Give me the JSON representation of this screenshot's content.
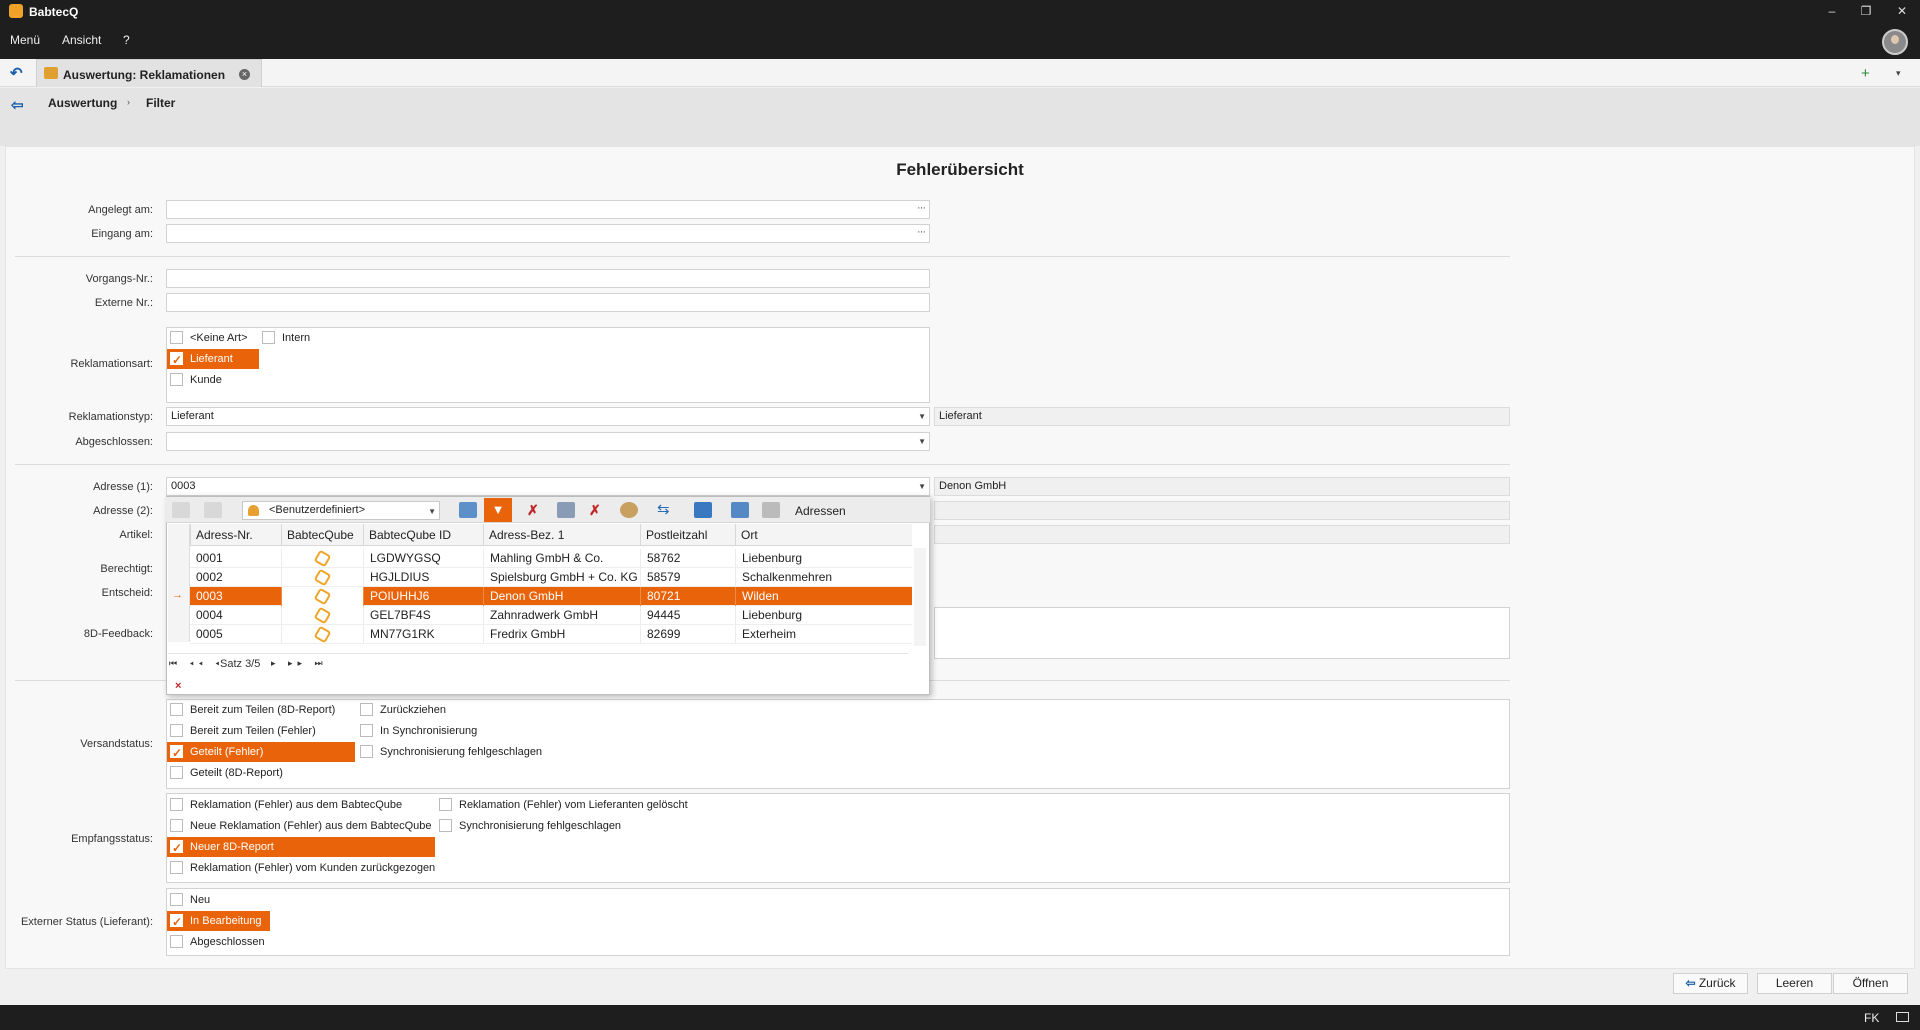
{
  "app": {
    "title": "BabtecQ",
    "menu": [
      "Menü",
      "Ansicht",
      "?"
    ]
  },
  "tabs": {
    "active_label": "Auswertung: Reklamationen"
  },
  "breadcrumb": [
    "Auswertung",
    "Filter"
  ],
  "page_title": "Fehlerübersicht",
  "fields": {
    "angelegt_label": "Angelegt am:",
    "eingang_label": "Eingang am:",
    "vorgang_label": "Vorgangs-Nr.:",
    "extern_label": "Externe Nr.:",
    "reklamationsart_label": "Reklamationsart:",
    "reklamationstyp_label": "Reklamationstyp:",
    "reklamationstyp_value": "Lieferant",
    "reklamationstyp_display": "Lieferant",
    "abgeschlossen_label": "Abgeschlossen:",
    "adresse1_label": "Adresse (1):",
    "adresse1_value": "0003",
    "adresse1_display": "Denon GmbH",
    "adresse2_label": "Adresse (2):",
    "artikel_label": "Artikel:",
    "berechtigt_label": "Berechtigt:",
    "entscheid_label": "Entscheid:",
    "feedback_label": "8D-Feedback:",
    "versand_label": "Versandstatus:",
    "empfang_label": "Empfangsstatus:",
    "extstatus_label": "Externer Status (Lieferant):"
  },
  "reklamationsart": [
    "<Keine Art>",
    "Intern",
    "Lieferant",
    "Kunde"
  ],
  "versandstatus": [
    "Bereit zum Teilen (8D-Report)",
    "Bereit zum Teilen (Fehler)",
    "Geteilt (Fehler)",
    "Geteilt (8D-Report)",
    "Zurückziehen",
    "In Synchronisierung",
    "Synchronisierung fehlgeschlagen"
  ],
  "empfangsstatus": [
    "Reklamation (Fehler) aus dem BabtecQube",
    "Neue Reklamation (Fehler) aus dem BabtecQube",
    "Neuer 8D-Report",
    "Reklamation (Fehler) vom Kunden zurückgezogen",
    "Reklamation (Fehler) vom Lieferanten gelöscht",
    "Synchronisierung fehlgeschlagen"
  ],
  "externer_status": [
    "Neu",
    "In Bearbeitung",
    "Abgeschlossen"
  ],
  "popup": {
    "layout_select": "<Benutzerdefiniert>",
    "title": "Adressen",
    "columns": [
      "Adress-Nr.",
      "BabtecQube",
      "BabtecQube ID",
      "Adress-Bez. 1",
      "Postleitzahl",
      "Ort"
    ],
    "rows": [
      {
        "nr": "0001",
        "id": "LGDWYGSQ",
        "bez": "Mahling GmbH & Co.",
        "plz": "58762",
        "ort": "Liebenburg"
      },
      {
        "nr": "0002",
        "id": "HGJLDIUS",
        "bez": "Spielsburg GmbH + Co. KG",
        "plz": "58579",
        "ort": "Schalkenmehren"
      },
      {
        "nr": "0003",
        "id": "POIUHHJ6",
        "bez": "Denon GmbH",
        "plz": "80721",
        "ort": "Wilden"
      },
      {
        "nr": "0004",
        "id": "GEL7BF4S",
        "bez": "Zahnradwerk GmbH",
        "plz": "94445",
        "ort": "Liebenburg"
      },
      {
        "nr": "0005",
        "id": "MN77G1RK",
        "bez": "Fredrix GmbH",
        "plz": "82699",
        "ort": "Exterheim"
      }
    ],
    "record": "Satz 3/5"
  },
  "buttons": {
    "zurueck": "Zurück",
    "leeren": "Leeren",
    "oeffnen": "Öffnen"
  },
  "statusbar": {
    "user": "FK"
  },
  "colors": {
    "accent": "#e8630a",
    "titlebar": "#1e1e1e"
  }
}
